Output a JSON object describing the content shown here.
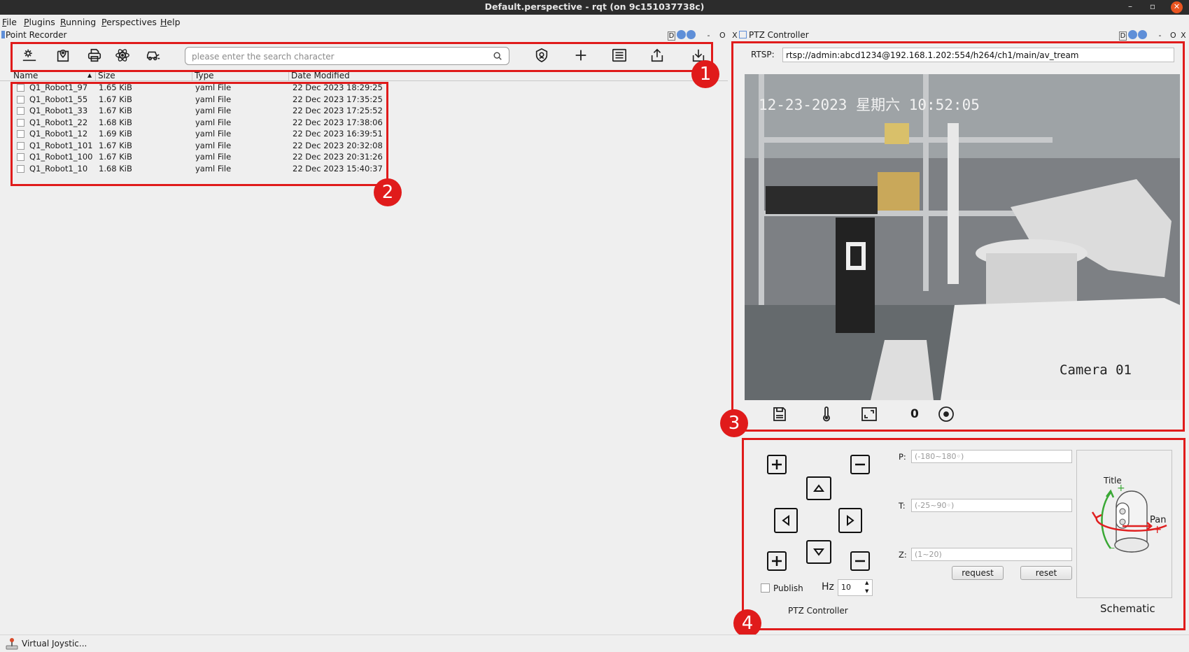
{
  "window": {
    "title": "Default.perspective - rqt (on 9c151037738c)",
    "min": "–",
    "max": "▫",
    "close": "✕"
  },
  "menu": [
    "File",
    "Plugins",
    "Running",
    "Perspectives",
    "Help"
  ],
  "docks": {
    "left_title": "Point Recorder",
    "right_title": "PTZ Controller",
    "ctl_d": "D",
    "ctl_min": "-",
    "ctl_float": "O",
    "ctl_close": "X"
  },
  "toolbar": {
    "search_placeholder": "please enter the search character",
    "icons": [
      "settings-icon",
      "map-pin-icon",
      "printer-icon",
      "atom-icon",
      "car-icon",
      "shield-icon",
      "plus-icon",
      "list-icon",
      "upload-icon",
      "download-icon"
    ]
  },
  "file_table": {
    "columns": [
      "Name",
      "Size",
      "Type",
      "Date Modified"
    ],
    "rows": [
      {
        "name": "Q1_Robot1_97",
        "size": "1.65 KiB",
        "type": "yaml File",
        "date": "22 Dec 2023 18:29:25"
      },
      {
        "name": "Q1_Robot1_55",
        "size": "1.67 KiB",
        "type": "yaml File",
        "date": "22 Dec 2023 17:35:25"
      },
      {
        "name": "Q1_Robot1_33",
        "size": "1.67 KiB",
        "type": "yaml File",
        "date": "22 Dec 2023 17:25:52"
      },
      {
        "name": "Q1_Robot1_22",
        "size": "1.68 KiB",
        "type": "yaml File",
        "date": "22 Dec 2023 17:38:06"
      },
      {
        "name": "Q1_Robot1_12",
        "size": "1.69 KiB",
        "type": "yaml File",
        "date": "22 Dec 2023 16:39:51"
      },
      {
        "name": "Q1_Robot1_101",
        "size": "1.67 KiB",
        "type": "yaml File",
        "date": "22 Dec 2023 20:32:08"
      },
      {
        "name": "Q1_Robot1_100",
        "size": "1.67 KiB",
        "type": "yaml File",
        "date": "22 Dec 2023 20:31:26"
      },
      {
        "name": "Q1_Robot1_10",
        "size": "1.68 KiB",
        "type": "yaml File",
        "date": "22 Dec 2023 15:40:37"
      }
    ]
  },
  "annotations": {
    "b1": "1",
    "b2": "2",
    "b3": "3",
    "b4": "4",
    "color": "#e01b1b"
  },
  "ptz": {
    "rtsp_label": "RTSP:",
    "rtsp_url": "rtsp://admin:abcd1234@192.168.1.202:554/h264/ch1/main/av_tream",
    "video_timestamp": "12-23-2023 星期六 10:52:05",
    "video_camera": "Camera 01",
    "counter": "0",
    "p_label": "P:",
    "p_placeholder": "(-180~180◦)",
    "t_label": "T:",
    "t_placeholder": "(-25~90◦)",
    "z_label": "Z:",
    "z_placeholder": "(1~20)",
    "request": "request",
    "reset": "reset",
    "publish": "Publish",
    "hz_label": "Hz",
    "hz_value": "10",
    "controller_label": "PTZ Controller",
    "schematic_label": "Schematic",
    "schematic_title": "Title",
    "schematic_pan": "Pan",
    "schematic_plus": "+",
    "schematic_minus": "–"
  },
  "status": {
    "plugin": "Virtual Joystic..."
  }
}
